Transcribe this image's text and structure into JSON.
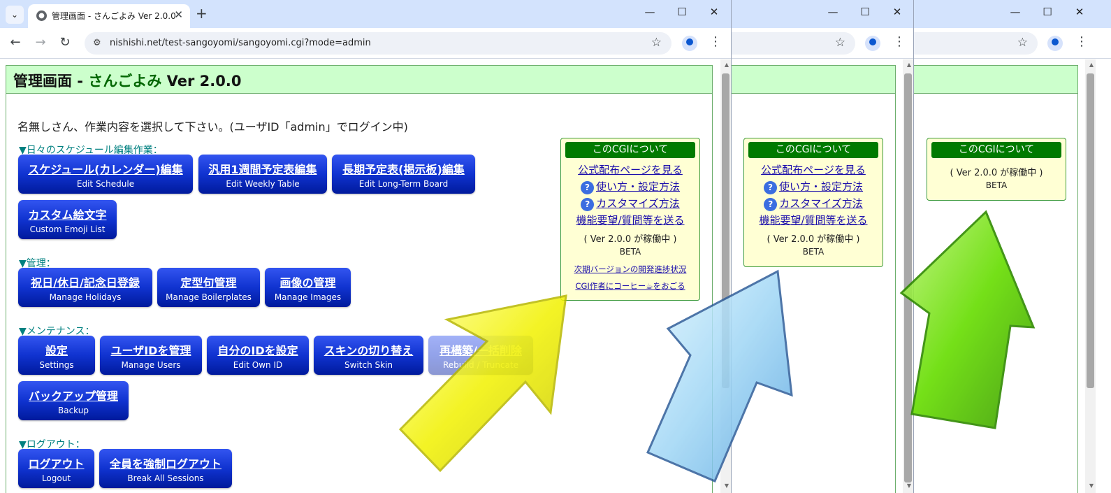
{
  "browser": {
    "tab_title": "管理画面 - さんごよみ Ver 2.0.0",
    "url": "nishishi.net/test-sangoyomi/sangoyomi.cgi?mode=admin",
    "icons": {
      "tab_list": "chevron-down-icon",
      "new_tab": "plus-icon",
      "back": "arrow-left-icon",
      "forward": "arrow-right-icon",
      "reload": "reload-icon",
      "site_info": "site-info-icon",
      "bookmark": "star-icon",
      "profile": "profile-icon",
      "menu": "kebab-menu-icon",
      "minimize": "minimize-icon",
      "maximize": "maximize-icon",
      "close": "close-icon"
    },
    "glyphs": {
      "tab_list": "⌄",
      "tab_close": "✕",
      "new_tab": "+",
      "back": "←",
      "forward": "→",
      "reload": "↻",
      "site_info": "⚙",
      "star": "☆",
      "kebab": "⋮",
      "minimize": "—",
      "maximize": "☐",
      "close": "✕",
      "scroll_up": "▲",
      "scroll_down": "▼"
    }
  },
  "page": {
    "title_prefix": "管理画面 - ",
    "title_app": "さんごよみ",
    "title_version": " Ver 2.0.0",
    "welcome": "名無しさん、作業内容を選択して下さい。(ユーザID「admin」でログイン中)",
    "sections": {
      "schedule": "▼日々のスケジュール編集作業：",
      "manage": "▼管理：",
      "maintenance": "▼メンテナンス：",
      "logout": "▼ログアウト："
    },
    "buttons": {
      "edit_schedule": {
        "ja": "スケジュール(カレンダー)編集",
        "en": "Edit Schedule"
      },
      "edit_weekly": {
        "ja": "汎用1週間予定表編集",
        "en": "Edit Weekly Table"
      },
      "edit_longterm": {
        "ja": "長期予定表(掲示板)編集",
        "en": "Edit Long-Term Board"
      },
      "custom_emoji": {
        "ja": "カスタム絵文字",
        "en": "Custom Emoji List"
      },
      "holidays": {
        "ja": "祝日/休日/記念日登録",
        "en": "Manage Holidays"
      },
      "boilerplates": {
        "ja": "定型句管理",
        "en": "Manage Boilerplates"
      },
      "images": {
        "ja": "画像の管理",
        "en": "Manage Images"
      },
      "settings": {
        "ja": "設定",
        "en": "Settings"
      },
      "users": {
        "ja": "ユーザIDを管理",
        "en": "Manage Users"
      },
      "own_id": {
        "ja": "自分のIDを設定",
        "en": "Edit Own ID"
      },
      "skin": {
        "ja": "スキンの切り替え",
        "en": "Switch Skin"
      },
      "rebuild": {
        "ja": "再構築/一括削除",
        "en": "Rebuild / Truncate"
      },
      "backup": {
        "ja": "バックアップ管理",
        "en": "Backup"
      },
      "logout": {
        "ja": "ログアウト",
        "en": "Logout"
      },
      "break_sessions": {
        "ja": "全員を強制ログアウト",
        "en": "Break All Sessions"
      }
    }
  },
  "about_box": {
    "heading": "このCGIについて",
    "link_official": "公式配布ページを見る",
    "link_usage": "使い方・設定方法",
    "link_customize": "カスタマイズ方法",
    "link_feedback": "機能要望/質問等を送る",
    "help_glyph": "?",
    "version_line": "( Ver 2.0.0 が稼働中 )",
    "beta": "BETA",
    "link_progress": "次期バージョンの開発進捗状況",
    "link_coffee": "CGI作者にコーヒー☕をおごる"
  },
  "colors": {
    "header_bg": "#ccffcc",
    "accent_green": "#007a00",
    "button_blue": "#1033d0",
    "box_bg": "#ffffd4",
    "arrow_yellow": "#f2f200",
    "arrow_blue": "#9fd6f5",
    "arrow_green": "#66dd00"
  }
}
